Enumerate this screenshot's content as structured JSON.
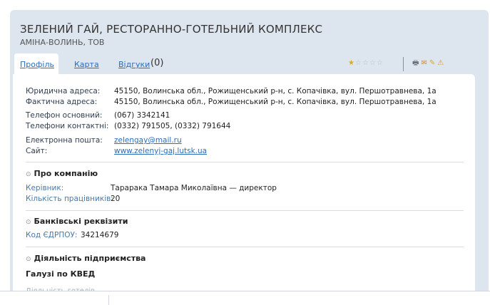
{
  "header": {
    "title": "ЗЕЛЕНИЙ ГАЙ, РЕСТОРАННО-ГОТЕЛЬНИЙ КОМПЛЕКС",
    "subtitle": "АМІНА-ВОЛИНЬ, ТОВ"
  },
  "tabs": {
    "profile": "Профіль",
    "map": "Карта",
    "reviews": "Відгуки",
    "reviews_count": "(0)"
  },
  "rating": {
    "value": 1,
    "max": 5
  },
  "toolbar_icons": [
    "print-icon",
    "mail-icon",
    "edit-icon",
    "warning-icon"
  ],
  "contacts": {
    "legal_address_label": "Юридична адреса:",
    "legal_address": "45150, Волинська обл., Рожищенський р-н, с. Копачівка, вул. Першотравнева, 1а",
    "actual_address_label": "Фактична адреса:",
    "actual_address": "45150, Волинська обл., Рожищенський р-н, с. Копачівка, вул. Першотравнева, 1а",
    "phone_main_label": "Телефон основний:",
    "phone_main": "(067) 3342141",
    "phones_contact_label": "Телефони контактні:",
    "phones_contact": "(0332) 791505, (0332) 791644",
    "email_label": "Електронна пошта:",
    "email": "zelengay@mail.ru",
    "site_label": "Сайт:",
    "site": "www.zelenyj-gaj.lutsk.ua"
  },
  "about": {
    "title": "Про компанію",
    "head_label": "Керівник:",
    "head": "Тарарака Тамара Миколаївна — директор",
    "employees_label": "Кількість працівників:",
    "employees": "20"
  },
  "bank": {
    "title": "Банківські реквізити",
    "edrpou_label": "Код ЄДРПОУ:",
    "edrpou": "34214679"
  },
  "activity": {
    "title": "Діяльність підприємства",
    "kved_title": "Галузі по КВЕД",
    "cutoff_text": "Діяльність готелів"
  }
}
